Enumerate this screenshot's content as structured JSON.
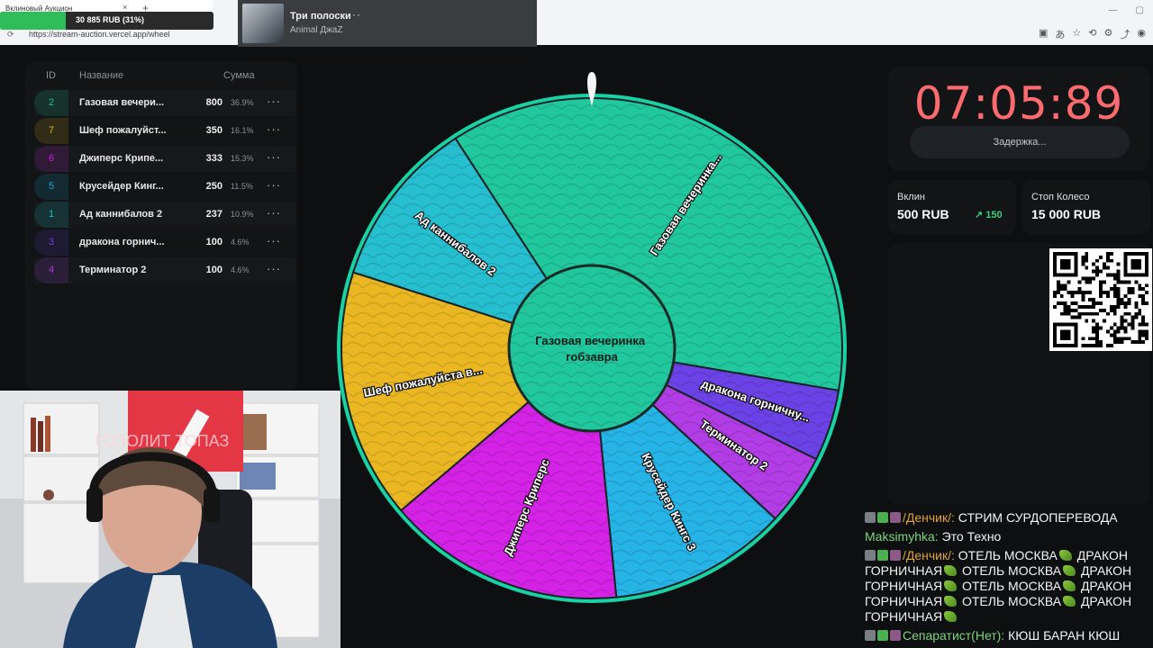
{
  "browser": {
    "tab_title": "Вклиновый Аукцион",
    "progress_text": "30 885 RUB (31%)",
    "progress_fraction": 0.31,
    "url": "https://stream-auction.vercel.app/wheel",
    "close_glyph": "×",
    "new_tab_glyph": "+"
  },
  "music": {
    "title": "Три полоски",
    "artist": "Animal ДжаZ",
    "more_glyph": "···"
  },
  "table": {
    "headers": {
      "id": "ID",
      "name": "Название",
      "sum": "Сумма"
    },
    "rows": [
      {
        "id": "2",
        "name": "Газовая вечери...",
        "sum": "800",
        "pct": "36.9%",
        "color": "#1fbf95"
      },
      {
        "id": "7",
        "name": "Шеф пожалуйст...",
        "sum": "350",
        "pct": "16.1%",
        "color": "#e3b21f"
      },
      {
        "id": "6",
        "name": "Джиперс Крипе...",
        "sum": "333",
        "pct": "15.3%",
        "color": "#c61fd6"
      },
      {
        "id": "5",
        "name": "Крусейдер Кинг...",
        "sum": "250",
        "pct": "11.5%",
        "color": "#1fa6d6"
      },
      {
        "id": "1",
        "name": "Ад каннибалов 2",
        "sum": "237",
        "pct": "10.9%",
        "color": "#1fc0c9"
      },
      {
        "id": "3",
        "name": "дракона горнич...",
        "sum": "100",
        "pct": "4.6%",
        "color": "#6a3fe0"
      },
      {
        "id": "4",
        "name": "Терминатор 2",
        "sum": "100",
        "pct": "4.6%",
        "color": "#a93be0"
      }
    ],
    "more_glyph": "···"
  },
  "wheel": {
    "center_label": "Газовая вечеринка гобзавра",
    "segments": [
      {
        "label": "Газовая вечеринка...",
        "value": 800,
        "color": "#21c79d"
      },
      {
        "label": "дракона горничну...",
        "value": 100,
        "color": "#6a42e6"
      },
      {
        "label": "Терминатор 2",
        "value": 100,
        "color": "#b23de6"
      },
      {
        "label": "Крусейдер Кингс 3",
        "value": 250,
        "color": "#26b3e6"
      },
      {
        "label": "Джиперс Криперс",
        "value": 333,
        "color": "#d422e6"
      },
      {
        "label": "Шеф пожалуйста в...",
        "value": 350,
        "color": "#eab722"
      },
      {
        "label": "Ад каннибалов 2",
        "value": 237,
        "color": "#26bfd0"
      }
    ],
    "start_angle_deg": -123,
    "rim_color": "#18d2a4"
  },
  "timer": {
    "value": "07:05:89",
    "delay_label": "Задержка..."
  },
  "stats": {
    "vklin_label": "Вклин",
    "vklin_value": "500 RUB",
    "vklin_trend": "150",
    "stop_label": "Стоп Колесо",
    "stop_value": "15 000 RUB"
  },
  "chat": [
    {
      "nick": "/Денчик/:",
      "nick_class": "nick-orange",
      "badges": 3,
      "text": "СТРИМ СУРДОПЕРЕВОДА"
    },
    {
      "nick": "Maksimyhka:",
      "nick_class": "nick-green",
      "badges": 0,
      "text": "Это Техно"
    },
    {
      "nick": "/Денчик/:",
      "nick_class": "nick-orange",
      "badges": 3,
      "text": "ОТЕЛЬ МОСКВА",
      "spam": true
    },
    {
      "nick": "Сепаратист(Нет):",
      "nick_class": "nick-green",
      "badges": 3,
      "text": "КЮШ БАРАН КЮШ"
    }
  ],
  "chat_spam": {
    "a": "ОТЕЛЬ МОСКВА",
    "b": "ДРАКОН ГОРНИЧНАЯ"
  }
}
